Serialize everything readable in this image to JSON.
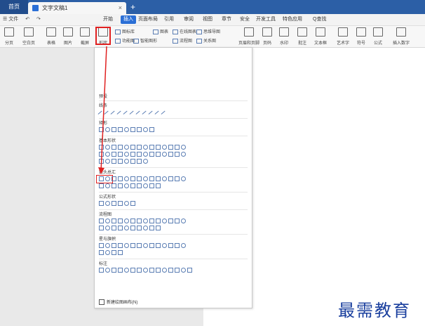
{
  "titlebar": {
    "home_label": "首页",
    "doc_title": "文字文稿1",
    "close_glyph": "×",
    "new_tab_glyph": "+"
  },
  "menubar": {
    "left_items": [
      "☰ 文件",
      "↶",
      "↷"
    ],
    "tabs": [
      {
        "label": "开始",
        "active": false
      },
      {
        "label": "插入",
        "active": true
      },
      {
        "label": "页面布局",
        "active": false
      },
      {
        "label": "引用",
        "active": false
      },
      {
        "label": "审阅",
        "active": false
      },
      {
        "label": "视图",
        "active": false
      },
      {
        "label": "章节",
        "active": false
      },
      {
        "label": "安全",
        "active": false
      },
      {
        "label": "开发工具",
        "active": false
      },
      {
        "label": "特色应用",
        "active": false
      },
      {
        "label": "Q查找",
        "active": false
      }
    ],
    "accent_color": "#2b6fd6"
  },
  "ribbon": {
    "big_buttons": [
      "分页",
      "空白页",
      "表格",
      "图片",
      "截屏",
      "形状"
    ],
    "middle_buttons": [
      "图标库",
      "功能图",
      "智能图形",
      "图表",
      "在线图表",
      "流程图",
      "思维导图",
      "关系图"
    ],
    "right_buttons": [
      "页眉和页脚",
      "页码",
      "水印",
      "批注",
      "文本框",
      "艺术字",
      "符号",
      "公式",
      "插入数字"
    ]
  },
  "dropdown": {
    "header": "预设",
    "sections": [
      {
        "title": "线条",
        "rows": [
          11
        ]
      },
      {
        "title": "矩形",
        "rows": [
          9
        ]
      },
      {
        "title": "基本形状",
        "rows": [
          14,
          14,
          8
        ]
      },
      {
        "title": "箭头总汇",
        "rows": [
          14,
          10
        ]
      },
      {
        "title": "公式形状",
        "rows": [
          6
        ]
      },
      {
        "title": "流程图",
        "rows": [
          14,
          10
        ]
      },
      {
        "title": "星与旗帜",
        "rows": [
          14,
          4
        ]
      },
      {
        "title": "标注",
        "rows": [
          15
        ]
      }
    ],
    "new_canvas_label": "新建绘图画布(N)"
  },
  "annotation": {
    "highlight_color": "#e02020"
  },
  "watermark": {
    "text": "最需教育"
  }
}
